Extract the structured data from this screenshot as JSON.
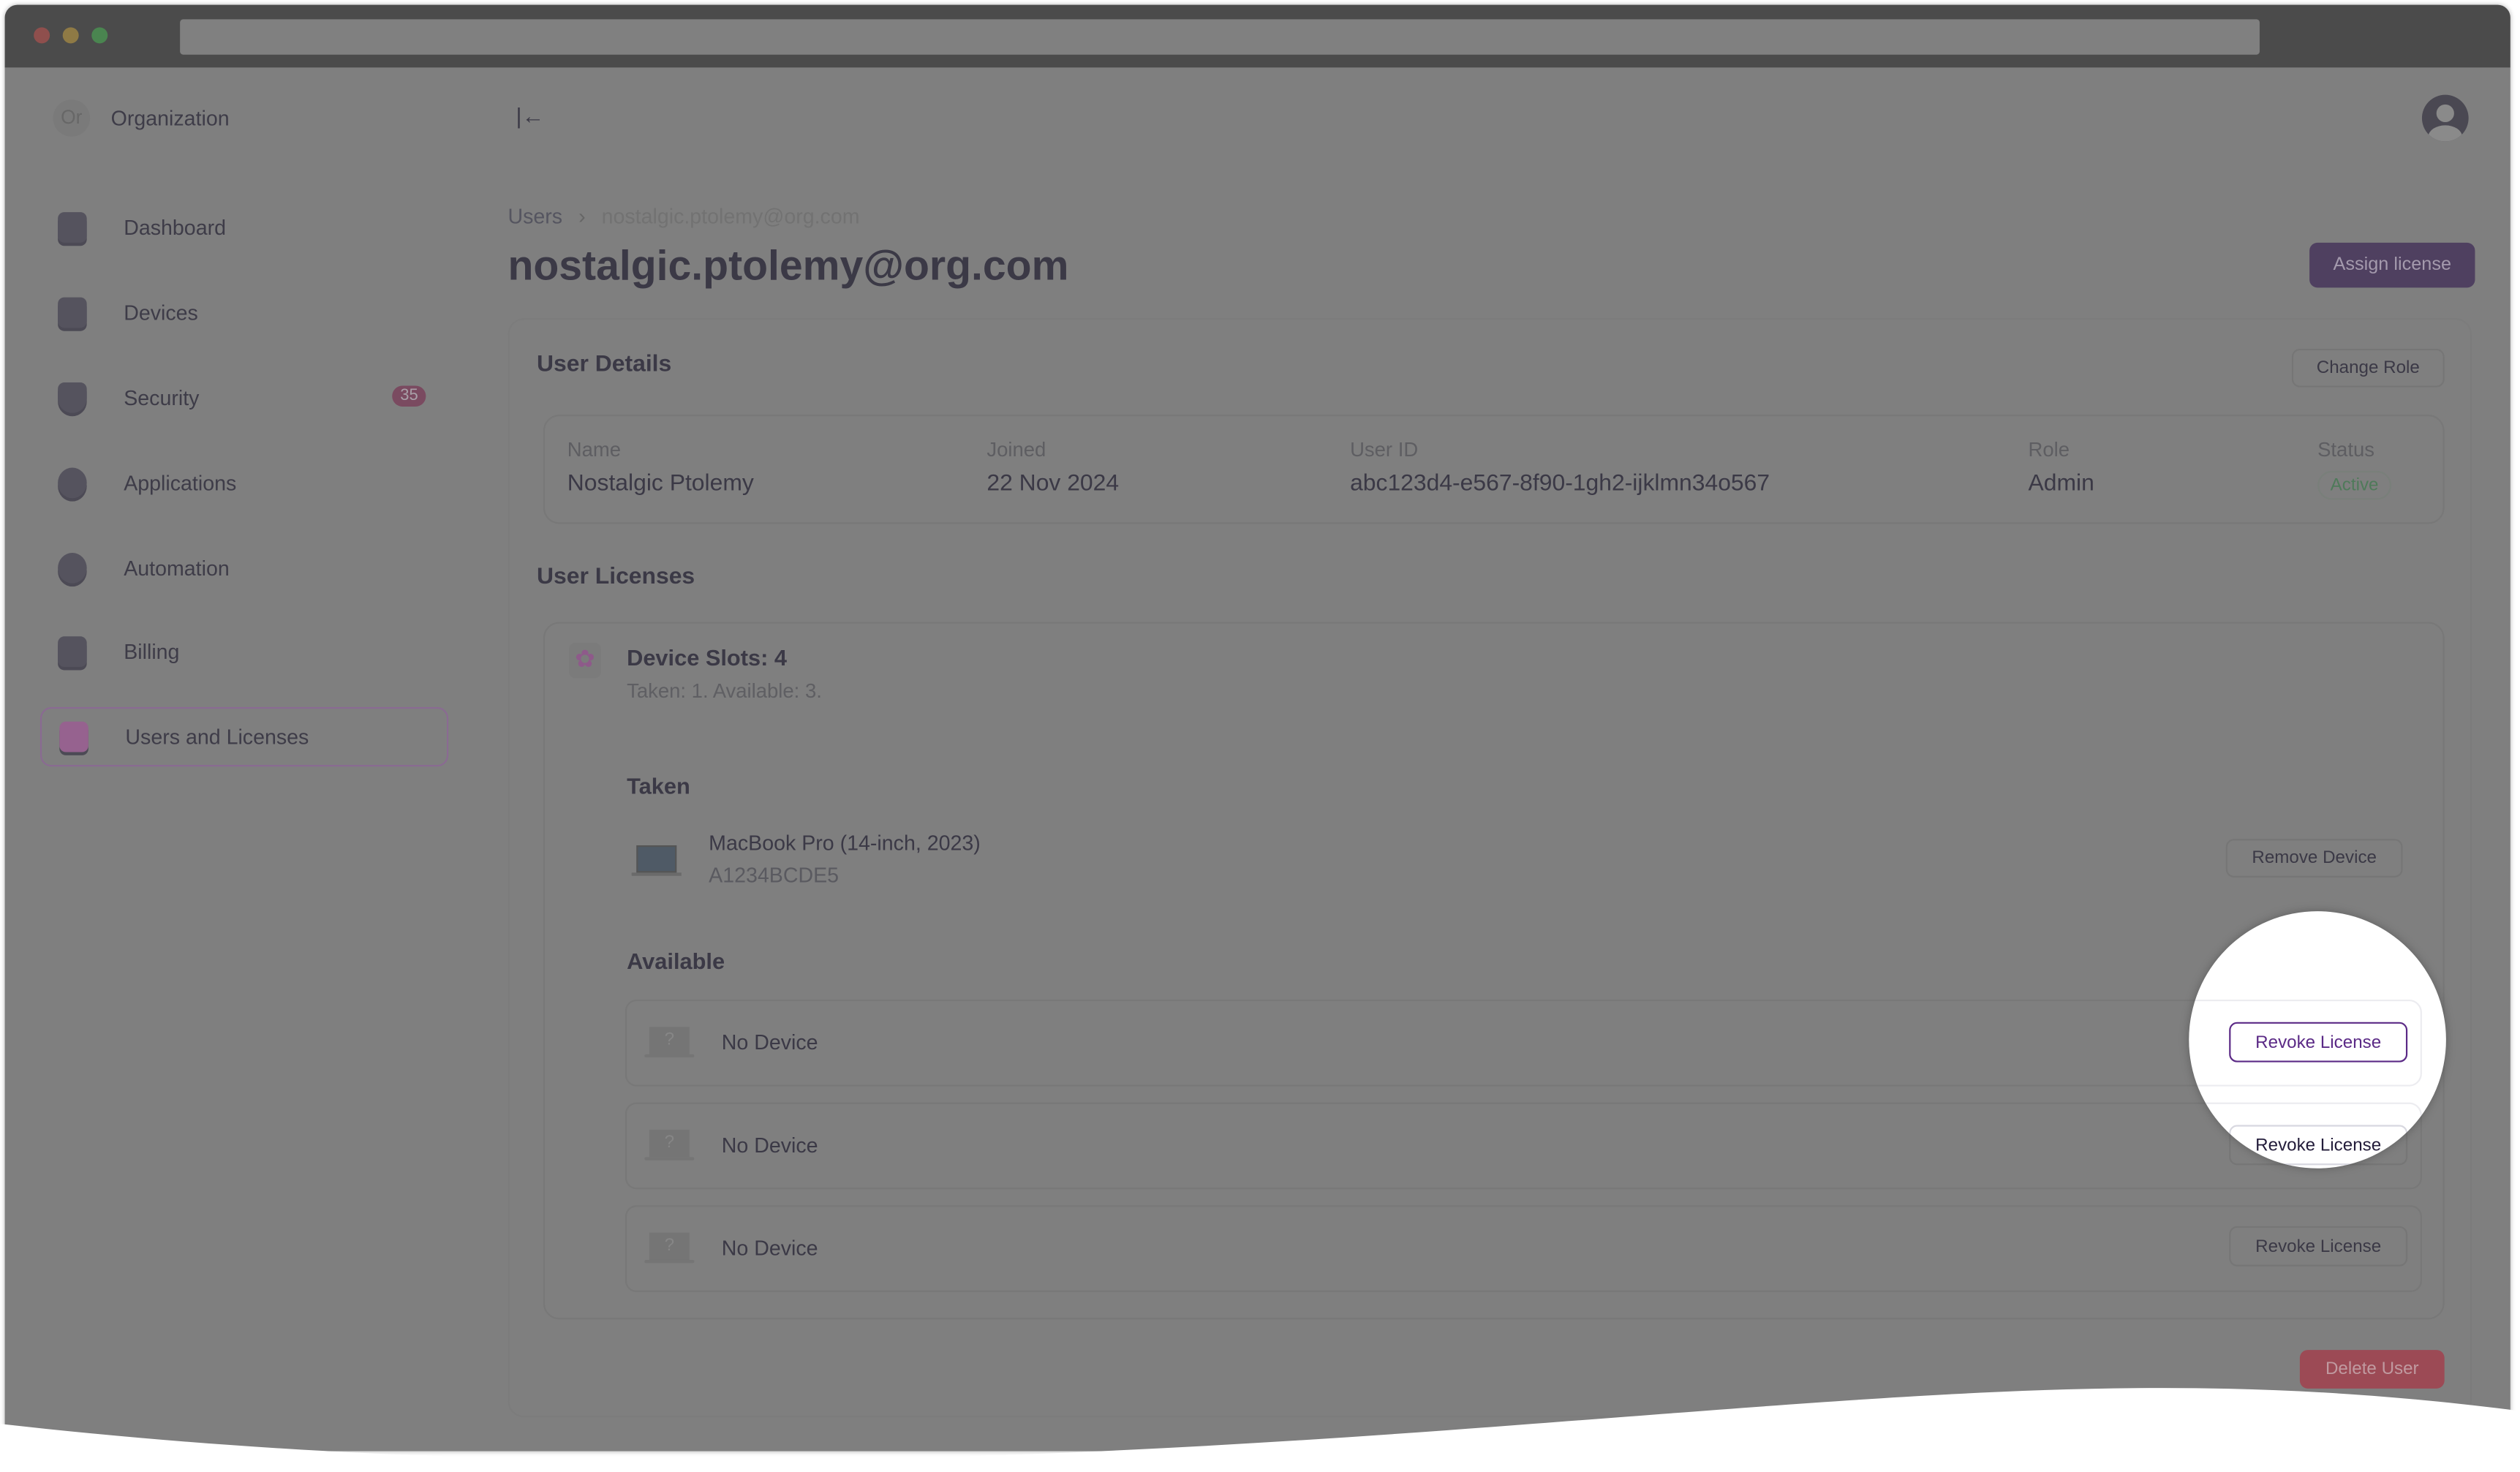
{
  "sidebar": {
    "org_initials": "Or",
    "org_name": "Organization",
    "items": [
      {
        "label": "Dashboard",
        "icon": "dashboard-icon"
      },
      {
        "label": "Devices",
        "icon": "devices-icon"
      },
      {
        "label": "Security",
        "icon": "shield-icon",
        "badge": "35"
      },
      {
        "label": "Applications",
        "icon": "applications-icon"
      },
      {
        "label": "Automation",
        "icon": "automation-icon"
      },
      {
        "label": "Billing",
        "icon": "billing-icon"
      },
      {
        "label": "Users and Licenses",
        "icon": "users-icon",
        "active": true
      }
    ]
  },
  "breadcrumb": {
    "parent": "Users",
    "separator": "›",
    "current": "nostalgic.ptolemy@org.com"
  },
  "page": {
    "title": "nostalgic.ptolemy@org.com",
    "assign_license": "Assign license"
  },
  "user_details": {
    "heading": "User Details",
    "change_role": "Change Role",
    "fields": [
      {
        "label": "Name",
        "value": "Nostalgic Ptolemy"
      },
      {
        "label": "Joined",
        "value": "22 Nov 2024"
      },
      {
        "label": "User ID",
        "value": "abc123d4-e567-8f90-1gh2-ijklmn34o567"
      },
      {
        "label": "Role",
        "value": "Admin"
      },
      {
        "label": "Status",
        "value": "Active"
      }
    ]
  },
  "licenses": {
    "heading": "User Licenses",
    "slots_title": "Device Slots: 4",
    "slots_sub": "Taken: 1. Available: 3.",
    "taken_heading": "Taken",
    "taken": [
      {
        "name": "MacBook Pro (14-inch, 2023)",
        "serial": "A1234BCDE5",
        "action": "Remove Device"
      }
    ],
    "available_heading": "Available",
    "available": [
      {
        "label": "No Device",
        "icon_glyph": "?",
        "action": "Revoke License"
      },
      {
        "label": "No Device",
        "icon_glyph": "?",
        "action": "Revoke License"
      },
      {
        "label": "No Device",
        "icon_glyph": "?",
        "action": "Revoke License"
      }
    ]
  },
  "delete_user": "Delete User",
  "colors": {
    "accent": "#5b2a86",
    "overlay": "#7f7f7f",
    "danger": "#9c4a55",
    "active_status": "#4f7a5a"
  }
}
